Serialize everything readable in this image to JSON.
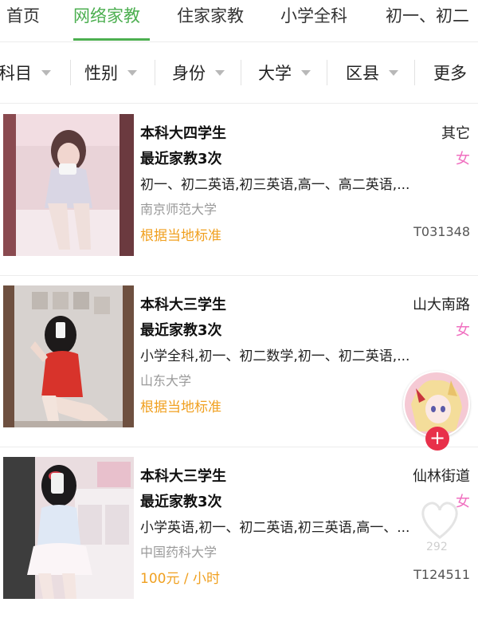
{
  "top_tabs": [
    {
      "label": "首页"
    },
    {
      "label": "网络家教",
      "active": true
    },
    {
      "label": "住家家教"
    },
    {
      "label": "小学全科"
    },
    {
      "label": "初一、初二"
    }
  ],
  "filters": [
    "科目",
    "性别",
    "身份",
    "大学",
    "区县",
    "更多"
  ],
  "listings": [
    {
      "degree": "本科大四学生",
      "sessions": "最近家教3次",
      "subjects": "初一、初二英语,初三英语,高一、高二英语,...",
      "school": "南京师范大学",
      "price": "根据当地标准",
      "location": "其它",
      "gender": "女",
      "code": "T031348"
    },
    {
      "degree": "本科大三学生",
      "sessions": "最近家教3次",
      "subjects": "小学全科,初一、初二数学,初一、初二英语,...",
      "school": "山东大学",
      "price": "根据当地标准",
      "location": "山大南路",
      "gender": "女",
      "code": ""
    },
    {
      "degree": "本科大三学生",
      "sessions": "最近家教3次",
      "subjects": "小学英语,初一、初二英语,初三英语,高一、...",
      "school": "中国药科大学",
      "price": "100元 / 小时",
      "location": "仙林街道",
      "gender": "女",
      "code": "T124511"
    }
  ],
  "overlay": {
    "follow_label": "+",
    "like_count": "292"
  },
  "colors": {
    "accent": "#4caf50",
    "price": "#f0a020",
    "gender": "#f070c0",
    "follow": "#e8304a"
  }
}
